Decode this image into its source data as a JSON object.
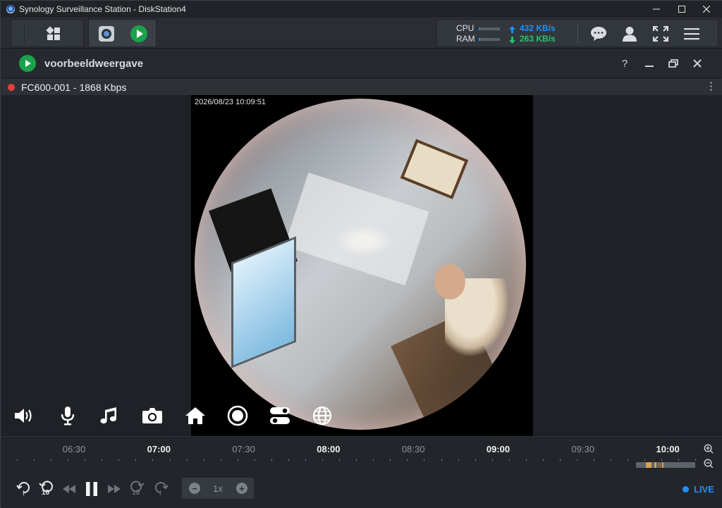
{
  "window": {
    "title": "Synology Surveillance Station - DiskStation4"
  },
  "toolbar": {
    "perf": {
      "cpu_label": "CPU",
      "ram_label": "RAM",
      "cpu_level": 0.03,
      "ram_level": 0.05,
      "upload": "432 KB/s",
      "download": "263 KB/s",
      "accent": "#1e90ff",
      "download_color": "#27c56b"
    },
    "icons": [
      "apps-icon",
      "camera-icon",
      "live-view-icon",
      "chat-icon",
      "user-icon",
      "fullscreen-icon",
      "menu-icon"
    ]
  },
  "panel": {
    "title": "voorbeeldweergave",
    "help": "?",
    "accent": "#1aa34a"
  },
  "camera": {
    "label": "FC600-001 - 1868 Kbps",
    "status_color": "#e4403c",
    "timestamp": "2026/08/23 10:09:51"
  },
  "timeline": {
    "labels": [
      {
        "text": "06:30",
        "major": false
      },
      {
        "text": "07:00",
        "major": true
      },
      {
        "text": "07:30",
        "major": false
      },
      {
        "text": "08:00",
        "major": true
      },
      {
        "text": "08:30",
        "major": false
      },
      {
        "text": "09:00",
        "major": true
      },
      {
        "text": "09:30",
        "major": false
      },
      {
        "text": "10:00",
        "major": true
      }
    ]
  },
  "playback": {
    "speed": "1x",
    "live_label": "LIVE",
    "skip_back_label": "10",
    "skip_forward_label": "10"
  }
}
